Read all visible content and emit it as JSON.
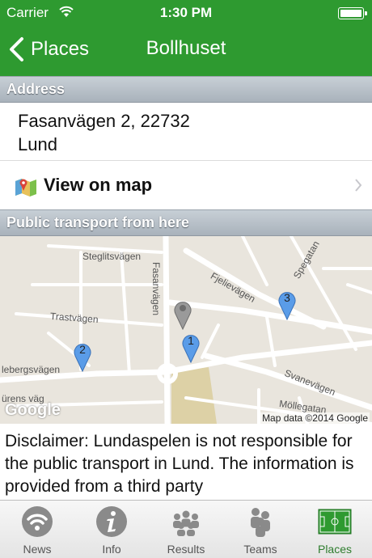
{
  "status_bar": {
    "carrier": "Carrier",
    "time": "1:30 PM"
  },
  "nav": {
    "back_label": "Places",
    "title": "Bollhuset"
  },
  "sections": {
    "address_header": "Address",
    "transport_header": "Public transport from here"
  },
  "address": {
    "line1": "Fasanvägen 2, 22732",
    "line2": "Lund"
  },
  "map_link": {
    "label": "View on map"
  },
  "map": {
    "street_labels": [
      "Steglitsvägen",
      "Fasanvägen",
      "Fjelievägen",
      "Trastvägen",
      "lebergsvägen",
      "Svanevägen",
      "ürens väg",
      "Möllegatan",
      "Spegatan"
    ],
    "pins": [
      "1",
      "2",
      "3"
    ],
    "logo": "Google",
    "attribution": "Map data ©2014 Google"
  },
  "disclaimer": "Disclaimer: Lundaspelen is not responsible for the public transport in Lund. The information is provided from a third party",
  "tabs": [
    {
      "label": "News",
      "icon": "wifi-broadcast-icon"
    },
    {
      "label": "Info",
      "icon": "info-icon"
    },
    {
      "label": "Results",
      "icon": "group-icon"
    },
    {
      "label": "Teams",
      "icon": "team-icon"
    },
    {
      "label": "Places",
      "icon": "field-icon"
    }
  ],
  "selected_tab": "Places",
  "colors": {
    "brand_green": "#2e9a30",
    "pin_blue": "#5a9ce8",
    "pin_gray": "#9a9a9a"
  }
}
